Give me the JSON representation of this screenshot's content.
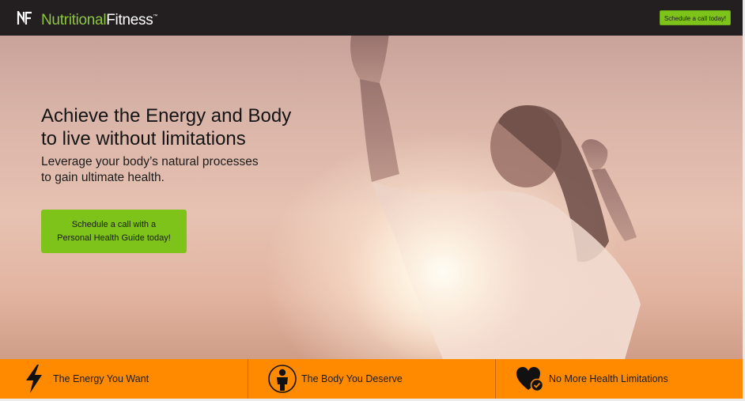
{
  "header": {
    "logo_mark": "NF",
    "logo_word_1": "Nutritional",
    "logo_word_2": "Fitness",
    "logo_tm": "™",
    "cta_label": "Schedule a call today!"
  },
  "hero": {
    "title": "Achieve the Energy and Body\nto live without limitations",
    "subtitle": "Leverage your body’s natural processes\nto gain ultimate health.",
    "cta_label": "Schedule a call with a\nPersonal Health Guide today!"
  },
  "features": [
    {
      "label": "The Energy You Want",
      "icon": "lightning-bolt-icon"
    },
    {
      "label": "The Body You Deserve",
      "icon": "body-silhouette-icon"
    },
    {
      "label": "No More Health Limitations",
      "icon": "heart-check-icon"
    }
  ],
  "colors": {
    "header_bg": "#231f20",
    "brand_green": "#8dc63f",
    "cta_green": "#7ec31a",
    "feature_orange": "#ff8a00"
  }
}
